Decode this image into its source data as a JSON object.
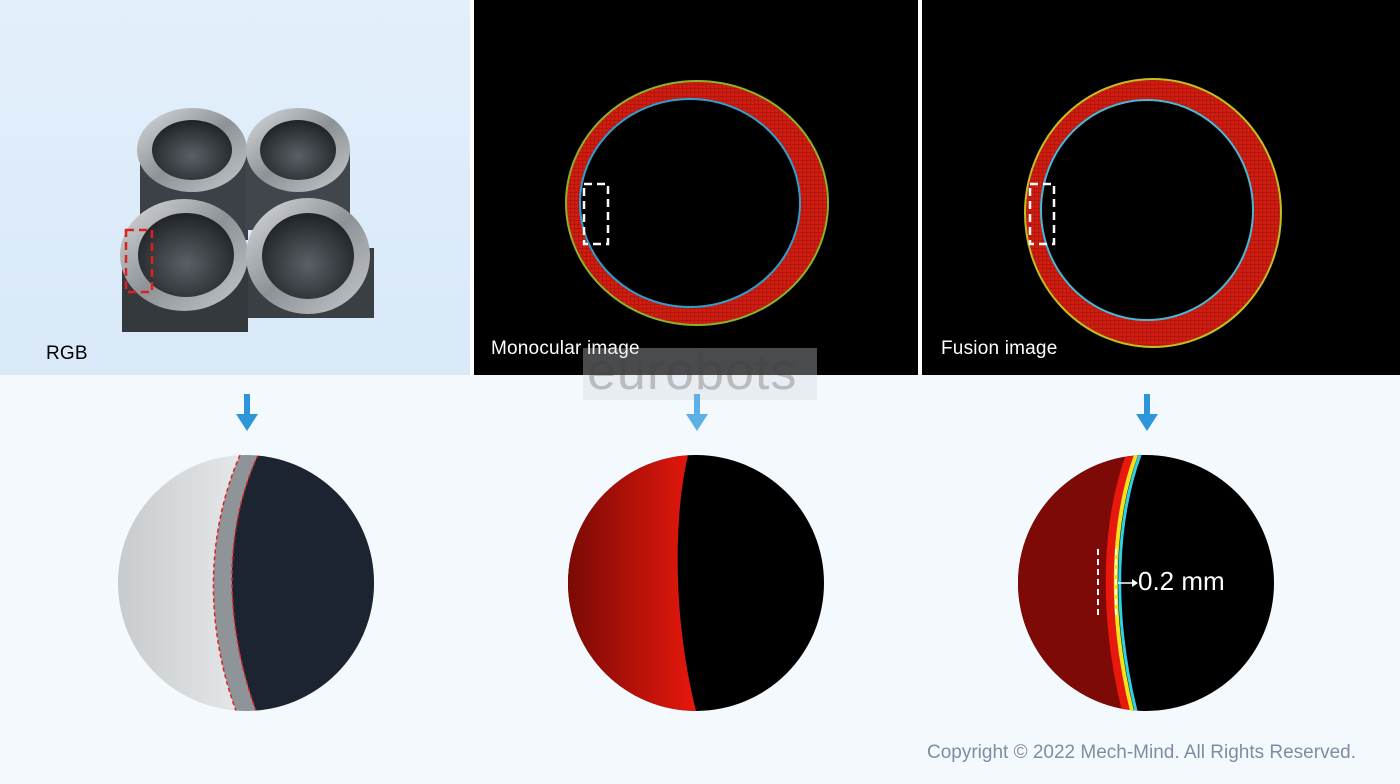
{
  "panels": {
    "rgb_label": "RGB",
    "monocular_label": "Monocular image",
    "fusion_label": "Fusion image"
  },
  "watermark": "eurobots",
  "measurement": "0.2 mm",
  "copyright": "Copyright © 2022 Mech-Mind. All Rights Reserved.",
  "colors": {
    "arrow": "#2e95d9",
    "ring_red": "#cc1a0e",
    "highlight_red": "#e02020",
    "background": "#f4f9fd"
  },
  "icons": [
    "down-arrow-icon",
    "selection-box-icon"
  ]
}
